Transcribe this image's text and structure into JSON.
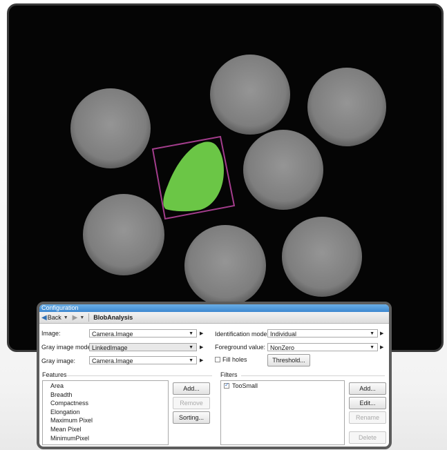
{
  "config_panel": {
    "title": "Configuration",
    "nav": {
      "back_label": "Back",
      "breadcrumb": "BlobAnalysis"
    },
    "fields": {
      "image_label": "Image:",
      "image_value": "Camera.Image",
      "gray_mode_label": "Gray image mode:",
      "gray_mode_value": "LinkedImage",
      "gray_image_label": "Gray image:",
      "gray_image_value": "Camera.Image",
      "ident_mode_label": "Identification mode:",
      "ident_mode_value": "Individual",
      "fg_label": "Foreground value:",
      "fg_value": "NonZero",
      "fill_holes_label": "Fill holes",
      "fill_holes_checked": false,
      "threshold_button": "Threshold..."
    },
    "features": {
      "label": "Features",
      "items": [
        "Area",
        "Breadth",
        "Compactness",
        "Elongation",
        "Maximum Pixel",
        "Mean Pixel",
        "MinimumPixel"
      ],
      "buttons": {
        "add": "Add...",
        "remove": "Remove",
        "sorting": "Sorting..."
      }
    },
    "filters": {
      "label": "Filters",
      "items": [
        {
          "label": "TooSmall",
          "checked": true
        }
      ],
      "buttons": {
        "add": "Add...",
        "edit": "Edit...",
        "rename": "Rename",
        "delete": "Delete"
      }
    }
  },
  "colors": {
    "blob_highlight": "#6bc646",
    "bounding_box": "#a33d8c",
    "title_bar": "#3d88d0",
    "disk_fill": "#8a8a8a"
  }
}
